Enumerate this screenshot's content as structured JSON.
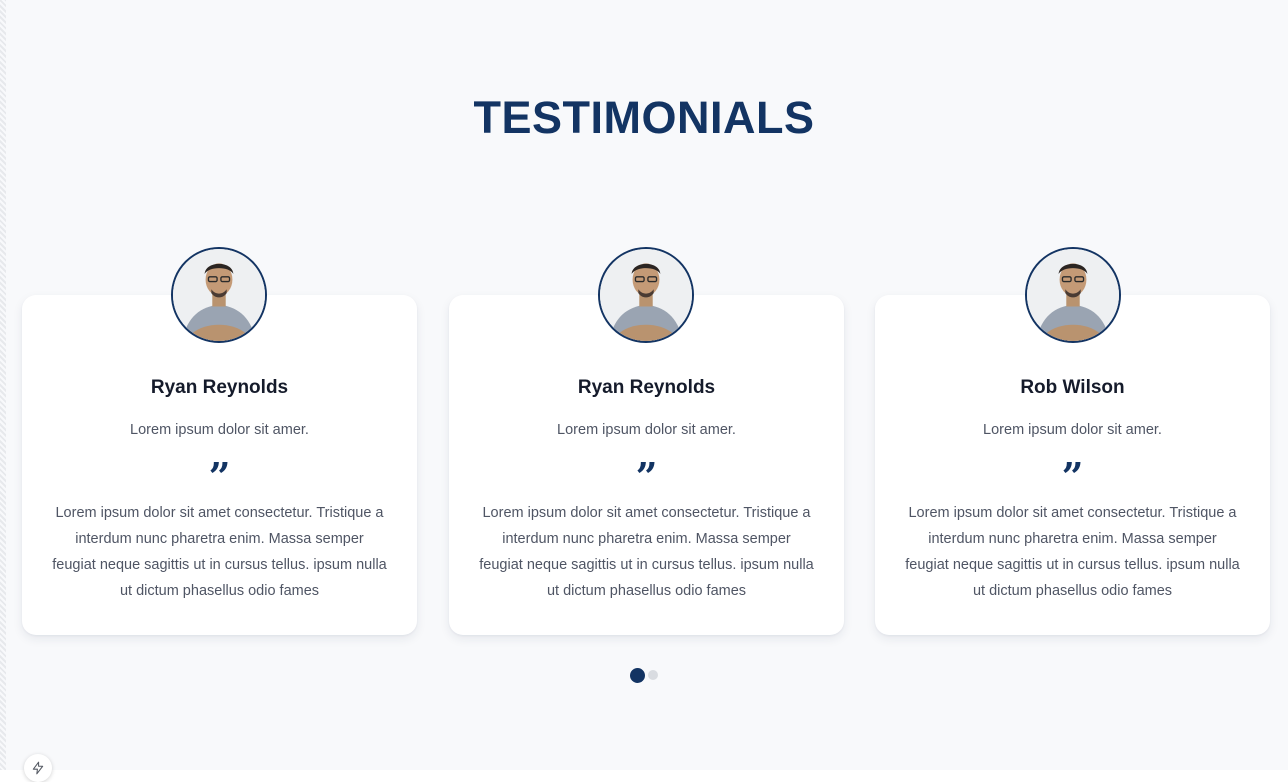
{
  "section": {
    "title": "TESTIMONIALS"
  },
  "testimonials": [
    {
      "name": "Ryan Reynolds",
      "role": "Lorem ipsum dolor sit amer.",
      "quote_icon": "quote-icon",
      "text": "Lorem ipsum dolor sit amet consectetur. Tristique a interdum nunc pharetra enim. Massa semper feugiat neque sagittis ut in cursus tellus. ipsum nulla ut dictum phasellus odio fames"
    },
    {
      "name": "Ryan Reynolds",
      "role": "Lorem ipsum dolor sit amer.",
      "quote_icon": "quote-icon",
      "text": "Lorem ipsum dolor sit amet consectetur. Tristique a interdum nunc pharetra enim. Massa semper feugiat neque sagittis ut in cursus tellus. ipsum nulla ut dictum phasellus odio fames"
    },
    {
      "name": "Rob Wilson",
      "role": "Lorem ipsum dolor sit amer.",
      "quote_icon": "quote-icon",
      "text": "Lorem ipsum dolor sit amet consectetur. Tristique a interdum nunc pharetra enim. Massa semper feugiat neque sagittis ut in cursus tellus. ipsum nulla ut dictum phasellus odio fames"
    }
  ],
  "pagination": {
    "pages": 2,
    "active_page": 1
  },
  "colors": {
    "brand_navy": "#133463",
    "background": "#f8f9fb",
    "card": "#ffffff",
    "text_muted": "#4f5564",
    "dot_inactive": "#d9dce1"
  },
  "icons": {
    "quote": "quote-icon",
    "fab": "lightning-icon"
  }
}
